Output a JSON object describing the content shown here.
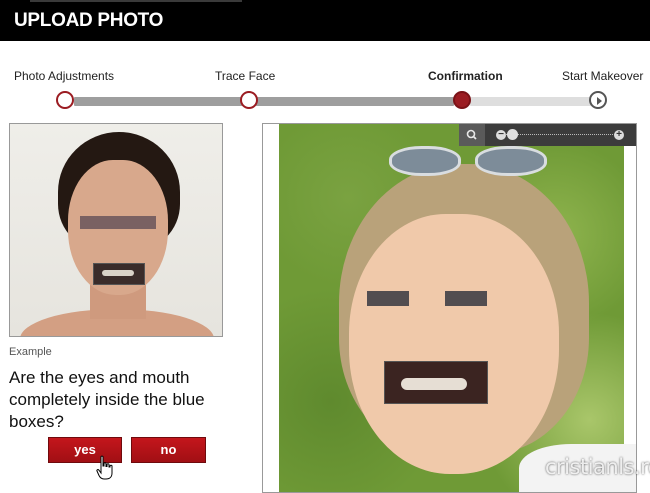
{
  "header": {
    "title": "UPLOAD PHOTO"
  },
  "stepper": {
    "steps": [
      {
        "label": "Photo Adjustments",
        "state": "done"
      },
      {
        "label": "Trace Face",
        "state": "done"
      },
      {
        "label": "Confirmation",
        "state": "current"
      },
      {
        "label": "Start Makeover",
        "state": "next"
      }
    ]
  },
  "example": {
    "label": "Example"
  },
  "question": {
    "text": "Are the eyes and mouth completely inside the blue boxes?"
  },
  "buttons": {
    "yes": "yes",
    "no": "no"
  },
  "zoom": {
    "level": 0.0
  },
  "watermark": {
    "text": "cristianls.ro"
  },
  "colors": {
    "accent": "#9b1c22",
    "button": "#b3131a",
    "header": "#000000"
  }
}
